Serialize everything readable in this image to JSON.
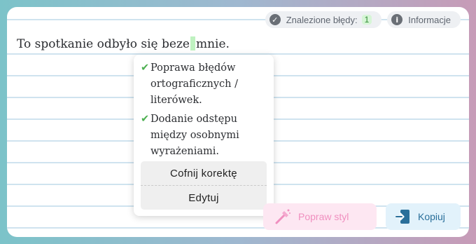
{
  "topbar": {
    "errors_label": "Znalezione błędy:",
    "errors_count": "1",
    "info_label": "Informacje",
    "info_icon_glyph": "i"
  },
  "editor": {
    "text_before": "To spotkanie odbyło się beze",
    "text_after": "mnie."
  },
  "popup": {
    "items": [
      {
        "check": "✔",
        "text": "Poprawa błędów ortograficznych / literówek."
      },
      {
        "check": "✔",
        "text": "Dodanie odstępu między osobnymi wyrażeniami."
      }
    ],
    "undo_label": "Cofnij korektę",
    "edit_label": "Edytuj"
  },
  "actions": {
    "style_label": "Popraw styl",
    "copy_label": "Kopiuj"
  },
  "colors": {
    "check": "#4caf50",
    "insert_highlight": "#bff2c0",
    "style_accent": "#f08fbf",
    "copy_accent": "#2a6f9a"
  }
}
